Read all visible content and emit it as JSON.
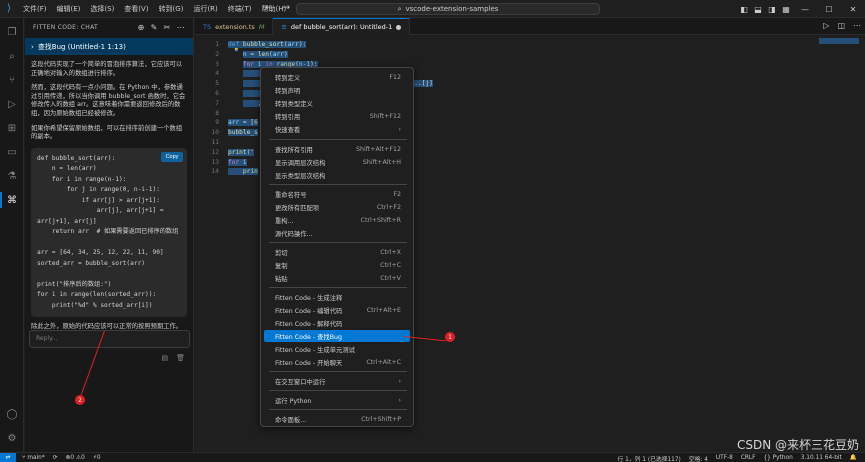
{
  "titlebar": {
    "menus": [
      "文件(F)",
      "编辑(E)",
      "选择(S)",
      "查看(V)",
      "转到(G)",
      "运行(R)",
      "终端(T)",
      "帮助(H)"
    ],
    "search": "vscode-extension-samples"
  },
  "sidepanel": {
    "header": "FITTEN CODE: CHAT",
    "chat_title": "查找Bug (Untitled-1 1:13)",
    "para1": "这段代码实现了一个简单的冒泡排序算法，它应该可以正确地对输入的数组进行排序。",
    "para2": "然而，这段代码有一点小问题。在 Python 中，参数通过引用传递，所以当你调用 bubble_sort 函数时，它会修改传入的数组 arr。这意味着你需要返回修改后的数组，因为原始数组已经被修改。",
    "para3": "如果你希望保留原始数组，可以在排序前创建一个数组的副本。",
    "copy_label": "Copy",
    "code_lines": [
      "def bubble_sort(arr):",
      "    n = len(arr)",
      "    for i in range(n-1):",
      "        for j in range(0, n-i-1):",
      "            if arr[j] > arr[j+1]:",
      "                arr[j], arr[j+1] =",
      "arr[j+1], arr[j]",
      "    return arr  # 如果需要返回已排序的数组",
      "",
      "arr = [64, 34, 25, 12, 22, 11, 90]",
      "sorted_arr = bubble_sort(arr)",
      "",
      "print(\"排序后的数组:\")",
      "for i in range(len(sorted_arr)):",
      "    print(\"%d\" % sorted_arr[i])"
    ],
    "summary": "除此之外，原始的代码应该可以正常的按照预期工作。",
    "reply_placeholder": "Reply..."
  },
  "tabs": [
    {
      "label": "extension.ts",
      "modified": "M"
    },
    {
      "label": "def bubble_sort(arr): Untitled-1"
    }
  ],
  "editor": {
    "line_numbers": [
      "1",
      "2",
      "3",
      "4",
      "5",
      "6",
      "7",
      "8",
      "9",
      "10",
      "11",
      "12",
      "13",
      "14"
    ]
  },
  "context_menu": {
    "items": [
      {
        "label": "转到定义",
        "shortcut": "F12"
      },
      {
        "label": "转到声明",
        "shortcut": ""
      },
      {
        "label": "转到类型定义",
        "shortcut": ""
      },
      {
        "label": "转到引用",
        "shortcut": "Shift+F12"
      },
      {
        "label": "快速查看",
        "shortcut": "›"
      },
      {
        "label": "查找所有引用",
        "shortcut": "Shift+Alt+F12"
      },
      {
        "label": "显示调用层次结构",
        "shortcut": "Shift+Alt+H"
      },
      {
        "label": "显示类型层次结构",
        "shortcut": ""
      },
      {
        "label": "重命名符号",
        "shortcut": "F2"
      },
      {
        "label": "更改所有匹配项",
        "shortcut": "Ctrl+F2"
      },
      {
        "label": "重构...",
        "shortcut": "Ctrl+Shift+R"
      },
      {
        "label": "源代码操作...",
        "shortcut": ""
      },
      {
        "label": "剪切",
        "shortcut": "Ctrl+X"
      },
      {
        "label": "复制",
        "shortcut": "Ctrl+C"
      },
      {
        "label": "粘贴",
        "shortcut": "Ctrl+V"
      },
      {
        "label": "Fitten Code - 生成注释",
        "shortcut": ""
      },
      {
        "label": "Fitten Code - 编辑代码",
        "shortcut": "Ctrl+Alt+E"
      },
      {
        "label": "Fitten Code - 解释代码",
        "shortcut": ""
      },
      {
        "label": "Fitten Code - 查找Bug",
        "shortcut": ""
      },
      {
        "label": "Fitten Code - 生成单元测试",
        "shortcut": ""
      },
      {
        "label": "Fitten Code - 开始聊天",
        "shortcut": "Ctrl+Alt+C"
      },
      {
        "label": "在交互窗口中运行",
        "shortcut": "›"
      },
      {
        "label": "运行 Python",
        "shortcut": "›"
      },
      {
        "label": "命令面板...",
        "shortcut": "Ctrl+Shift+P"
      }
    ]
  },
  "annotations": {
    "badge1": "1",
    "badge2": "2"
  },
  "statusbar": {
    "branch": "main*",
    "problems": "⊗0 ⚠0",
    "ports": "⚡0",
    "position": "行 1，列 1 (已选择117)",
    "spaces": "空格: 4",
    "encoding": "UTF-8",
    "eol": "CRLF",
    "lang": "{} Python",
    "interpreter": "3.10.11 64-bit"
  },
  "watermark": "CSDN @来杯三花豆奶",
  "colors": {
    "accent": "#0078d4",
    "annotation": "#e02020",
    "selection": "#264f78"
  }
}
